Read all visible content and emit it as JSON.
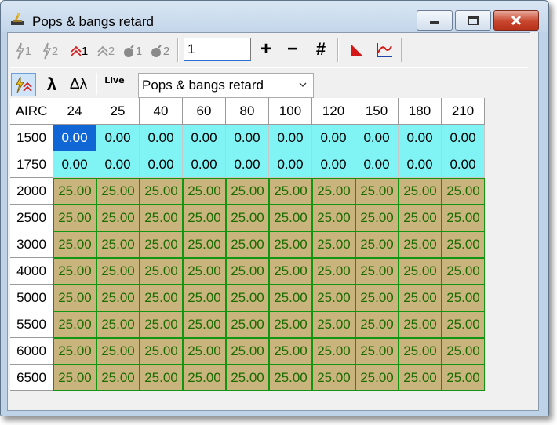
{
  "window": {
    "title": "Pops & bangs retard"
  },
  "toolbar1": {
    "buttons": [
      {
        "name": "cyl1-button",
        "label": "1",
        "icon": "spark-icon"
      },
      {
        "name": "cyl2-button",
        "label": "2",
        "icon": "spark-icon"
      },
      {
        "name": "flame1-button",
        "label": "1",
        "icon": "double-chevron-up-icon"
      },
      {
        "name": "flame2-button",
        "label": "2",
        "icon": "double-chevron-up-icon"
      },
      {
        "name": "bomb1-button",
        "label": "1",
        "icon": "bomb-icon"
      },
      {
        "name": "bomb2-button",
        "label": "2",
        "icon": "bomb-icon"
      }
    ],
    "value_input": "1",
    "plus_label": "+",
    "minus_label": "−",
    "hash_label": "#"
  },
  "toolbar2": {
    "lambda_label": "λ",
    "delta_lambda_label": "Δλ",
    "live_label": "Live",
    "map_select": "Pops & bangs retard"
  },
  "table": {
    "corner": "AIRC",
    "columns": [
      "24",
      "25",
      "40",
      "60",
      "80",
      "100",
      "120",
      "150",
      "180",
      "210"
    ],
    "rows": [
      {
        "rpm": "1500",
        "values": [
          "0.00",
          "0.00",
          "0.00",
          "0.00",
          "0.00",
          "0.00",
          "0.00",
          "0.00",
          "0.00",
          "0.00"
        ]
      },
      {
        "rpm": "1750",
        "values": [
          "0.00",
          "0.00",
          "0.00",
          "0.00",
          "0.00",
          "0.00",
          "0.00",
          "0.00",
          "0.00",
          "0.00"
        ]
      },
      {
        "rpm": "2000",
        "values": [
          "25.00",
          "25.00",
          "25.00",
          "25.00",
          "25.00",
          "25.00",
          "25.00",
          "25.00",
          "25.00",
          "25.00"
        ]
      },
      {
        "rpm": "2500",
        "values": [
          "25.00",
          "25.00",
          "25.00",
          "25.00",
          "25.00",
          "25.00",
          "25.00",
          "25.00",
          "25.00",
          "25.00"
        ]
      },
      {
        "rpm": "3000",
        "values": [
          "25.00",
          "25.00",
          "25.00",
          "25.00",
          "25.00",
          "25.00",
          "25.00",
          "25.00",
          "25.00",
          "25.00"
        ]
      },
      {
        "rpm": "4000",
        "values": [
          "25.00",
          "25.00",
          "25.00",
          "25.00",
          "25.00",
          "25.00",
          "25.00",
          "25.00",
          "25.00",
          "25.00"
        ]
      },
      {
        "rpm": "5000",
        "values": [
          "25.00",
          "25.00",
          "25.00",
          "25.00",
          "25.00",
          "25.00",
          "25.00",
          "25.00",
          "25.00",
          "25.00"
        ]
      },
      {
        "rpm": "5500",
        "values": [
          "25.00",
          "25.00",
          "25.00",
          "25.00",
          "25.00",
          "25.00",
          "25.00",
          "25.00",
          "25.00",
          "25.00"
        ]
      },
      {
        "rpm": "6000",
        "values": [
          "25.00",
          "25.00",
          "25.00",
          "25.00",
          "25.00",
          "25.00",
          "25.00",
          "25.00",
          "25.00",
          "25.00"
        ]
      },
      {
        "rpm": "6500",
        "values": [
          "25.00",
          "25.00",
          "25.00",
          "25.00",
          "25.00",
          "25.00",
          "25.00",
          "25.00",
          "25.00",
          "25.00"
        ]
      }
    ],
    "selected_cell": {
      "row": 0,
      "col": 0
    }
  },
  "colors": {
    "zero_cell": "#80f4f4",
    "value_cell": "#c8b47c",
    "value_text": "#1a6b00",
    "selected_cell": "#1166d6"
  }
}
